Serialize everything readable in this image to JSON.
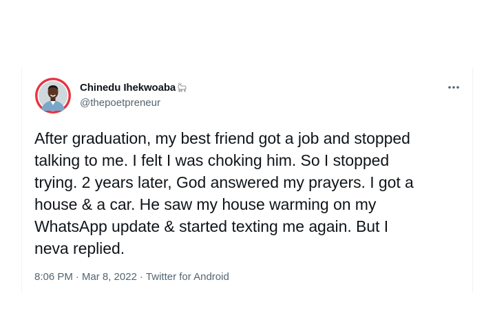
{
  "tweet": {
    "author": {
      "display_name": "Chinedu Ihekwoaba",
      "name_emoji": "goat-emoji-icon",
      "handle": "@thepoetpreneur"
    },
    "more_label": "More",
    "text": "After graduation, my best friend got a job and stopped\ntalking to me. I felt I was choking him. So I stopped\ntrying. 2 years later, God answered my prayers. I got a\nhouse & a car. He saw my house warming on my\nWhatsApp update & started texting me again. But I\nneva replied.",
    "meta": {
      "time": "8:06 PM",
      "date": "Mar 8, 2022",
      "separator": "·",
      "source": "Twitter for Android"
    }
  },
  "colors": {
    "primary_text": "#0f1419",
    "secondary_text": "#536471",
    "border": "#eff3f4",
    "avatar_ring": "#e8333f"
  }
}
